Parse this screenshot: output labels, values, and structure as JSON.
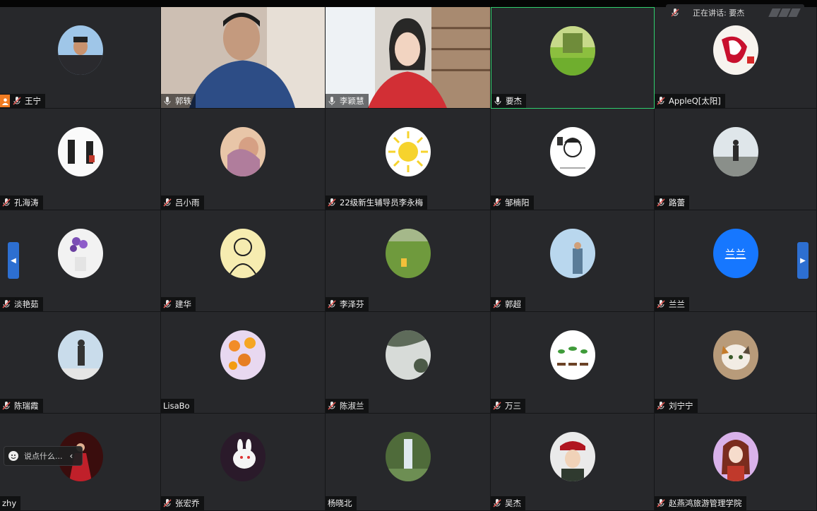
{
  "active_speaker": {
    "label": "正在讲话: 要杰"
  },
  "chat_input": {
    "placeholder": "说点什么..."
  },
  "colors": {
    "active_border": "#2fcf6e",
    "accent_blue": "#1677ff",
    "host_badge": "#f07c22",
    "mic_muted": "#d9534f"
  },
  "participants": [
    {
      "name": "王宁",
      "mic": "muted",
      "avatar": "photo-man",
      "host": true
    },
    {
      "name": "郭轶",
      "mic": "on",
      "avatar": "video"
    },
    {
      "name": "李颖慧",
      "mic": "on",
      "avatar": "video"
    },
    {
      "name": "要杰",
      "mic": "on",
      "avatar": "green-landscape",
      "active": true
    },
    {
      "name": "AppleQ[太阳]",
      "mic": "muted",
      "avatar": "red-fruit"
    },
    {
      "name": "孔海涛",
      "mic": "muted",
      "avatar": "dancers"
    },
    {
      "name": "吕小雨",
      "mic": "muted",
      "avatar": "girl-photo"
    },
    {
      "name": "22级新生辅导员李永梅",
      "mic": "muted",
      "avatar": "sun"
    },
    {
      "name": "邹楠阳",
      "mic": "muted",
      "avatar": "cartoon-girl"
    },
    {
      "name": "路蕾",
      "mic": "muted",
      "avatar": "city-view"
    },
    {
      "name": "淡艳茹",
      "mic": "muted",
      "avatar": "purple-flowers"
    },
    {
      "name": "建华",
      "mic": "muted",
      "avatar": "sketch-portrait"
    },
    {
      "name": "李泽芬",
      "mic": "muted",
      "avatar": "grass-field"
    },
    {
      "name": "郭超",
      "mic": "muted",
      "avatar": "outdoor-man"
    },
    {
      "name": "兰兰",
      "mic": "muted",
      "avatar": "text",
      "avatar_text": "兰兰"
    },
    {
      "name": "陈瑞霞",
      "mic": "muted",
      "avatar": "window-girl"
    },
    {
      "name": "LisaBo",
      "mic": "none",
      "avatar": "sunflowers"
    },
    {
      "name": "陈淑兰",
      "mic": "muted",
      "avatar": "snow-path"
    },
    {
      "name": "万三",
      "mic": "muted",
      "avatar": "sprouts"
    },
    {
      "name": "刘宁宁",
      "mic": "muted",
      "avatar": "cat"
    },
    {
      "name": "zhy",
      "mic": "none",
      "avatar": "red-dress"
    },
    {
      "name": "张宏乔",
      "mic": "muted",
      "avatar": "white-rabbit"
    },
    {
      "name": "杨晓北",
      "mic": "none",
      "avatar": "waterfall"
    },
    {
      "name": "吴杰",
      "mic": "muted",
      "avatar": "uniform-girl"
    },
    {
      "name": "赵燕鸿旅游管理学院",
      "mic": "muted",
      "avatar": "anime-girl"
    }
  ]
}
